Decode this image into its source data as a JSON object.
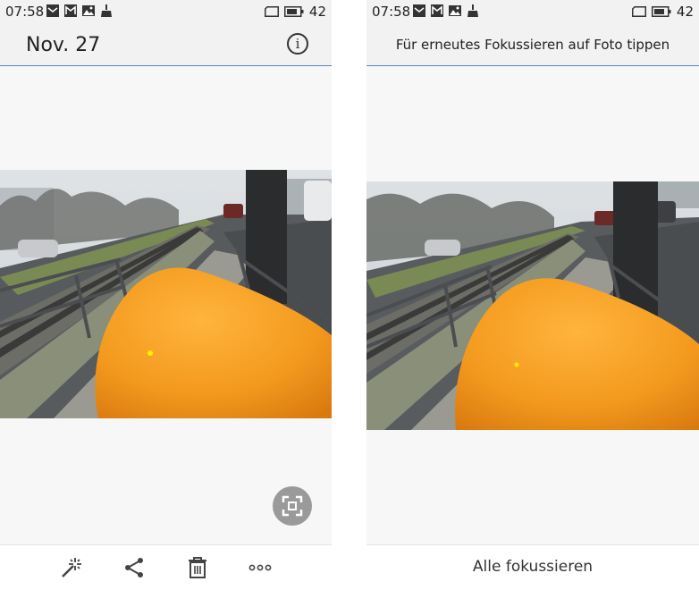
{
  "left": {
    "status": {
      "time": "07:58",
      "battery": "42"
    },
    "header": {
      "title": "Nov. 27",
      "info_icon": "info-icon"
    },
    "toolbar": {
      "icons": [
        "magic-wand-icon",
        "share-icon",
        "trash-icon",
        "more-icon"
      ]
    },
    "focus_button_icon": "focus-frame-icon"
  },
  "right": {
    "status": {
      "time": "07:58",
      "battery": "42"
    },
    "header": {
      "hint": "Für erneutes Fokussieren auf Foto tippen"
    },
    "bottom": {
      "action": "Alle fokussieren"
    }
  },
  "colors": {
    "accent_line": "#5b87b0",
    "bar_bg": "#f2f2f2",
    "focus_button": "#9a9a9a",
    "object_orange": "#f39a1e"
  }
}
